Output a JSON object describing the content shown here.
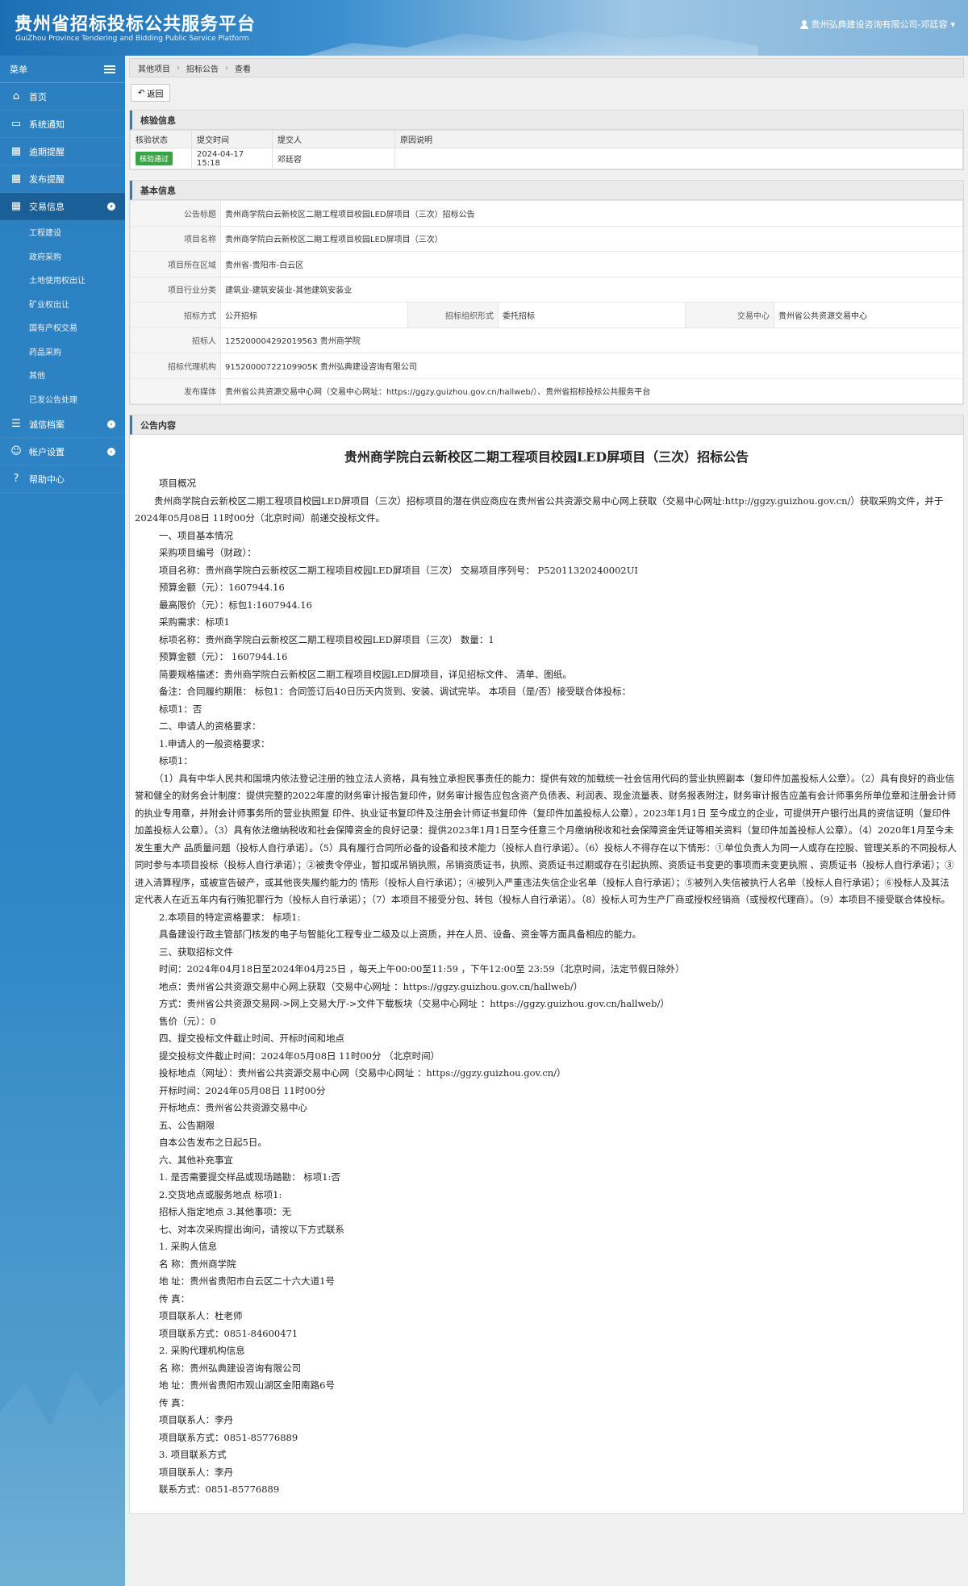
{
  "header": {
    "title": "贵州省招标投标公共服务平台",
    "subtitle": "GuiZhou Province Tendering and Bidding Public Service Platform",
    "user": "贵州弘典建设咨询有限公司-邓廷容"
  },
  "sidebar": {
    "menu_label": "菜单",
    "items": [
      {
        "label": "首页",
        "icon": "home-icon"
      },
      {
        "label": "系统通知",
        "icon": "monitor-icon"
      },
      {
        "label": "逾期提醒",
        "icon": "calendar-icon"
      },
      {
        "label": "发布提醒",
        "icon": "calendar-icon"
      },
      {
        "label": "交易信息",
        "icon": "calendar-icon"
      }
    ],
    "sub_items": [
      "工程建设",
      "政府采购",
      "土地使用权出让",
      "矿业权出让",
      "国有产权交易",
      "药品采购",
      "其他",
      "已发公告处理"
    ],
    "bottom_items": [
      {
        "label": "诚信档案",
        "icon": "list-icon"
      },
      {
        "label": "帐户设置",
        "icon": "user-icon"
      },
      {
        "label": "帮助中心",
        "icon": "help-icon"
      }
    ]
  },
  "breadcrumb": [
    "其他项目",
    "招标公告",
    "查看"
  ],
  "toolbar": {
    "back_label": "返回"
  },
  "audit": {
    "title": "核验信息",
    "headers": [
      "核验状态",
      "提交时间",
      "提交人",
      "原因说明"
    ],
    "status": "核验通过",
    "submit_time": "2024-04-17 15:18",
    "submitter": "邓廷容",
    "reason": ""
  },
  "basic": {
    "title": "基本信息",
    "notice_title_label": "公告标题",
    "notice_title": "贵州商学院白云新校区二期工程项目校园LED屏项目（三次）招标公告",
    "project_name_label": "项目名称",
    "project_name": "贵州商学院白云新校区二期工程项目校园LED屏项目（三次）",
    "region_label": "项目所在区域",
    "region": "贵州省-贵阳市-白云区",
    "industry_label": "项目行业分类",
    "industry": "建筑业-建筑安装业-其他建筑安装业",
    "method_label": "招标方式",
    "method": "公开招标",
    "org_form_label": "招标组织形式",
    "org_form": "委托招标",
    "center_label": "交易中心",
    "center": "贵州省公共资源交易中心",
    "tenderer_label": "招标人",
    "tenderer": "125200004292019563 贵州商学院",
    "agency_label": "招标代理机构",
    "agency": "91520000722109905K 贵州弘典建设咨询有限公司",
    "media_label": "发布媒体",
    "media": "贵州省公共资源交易中心网（交易中心网址：https://ggzy.guizhou.gov.cn/hallweb/）、贵州省招标投标公共服务平台"
  },
  "notice": {
    "section_title": "公告内容",
    "title": "贵州商学院白云新校区二期工程项目校园LED屏项目（三次）招标公告",
    "paragraphs": [
      "项目概况",
      "贵州商学院白云新校区二期工程项目校园LED屏项目（三次）招标项目的潜在供应商应在贵州省公共资源交易中心网上获取（交易中心网址:http://ggzy.guizhou.gov.cn/）获取采购文件，并于2024年05月08日 11时00分（北京时间）前递交投标文件。",
      "一、项目基本情况",
      "采购项目编号（财政）：",
      "项目名称：贵州商学院白云新校区二期工程项目校园LED屏项目（三次）   交易项目序列号： P52011320240002UI",
      "预算金额（元）：1607944.16",
      "最高限价（元）：标包1:1607944.16",
      "采购需求：标项1",
      "标项名称：贵州商学院白云新校区二期工程项目校园LED屏项目（三次）   数量：1",
      "预算金额（元）：  1607944.16",
      "简要规格描述：贵州商学院白云新校区二期工程项目校园LED屏项目，详见招标文件、  清单、图纸。",
      "备注：合同履约期限：  标包1：合同签订后40日历天内货到、安装、调试完毕。   本项目（是/否）接受联合体投标：",
      "标项1：否",
      "二、申请人的资格要求：",
      "1.申请人的一般资格要求：",
      "标项1：",
      "（1）具有中华人民共和国境内依法登记注册的独立法人资格，具有独立承担民事责任的能力：提供有效的加载统一社会信用代码的营业执照副本（复印件加盖投标人公章）。（2）具有良好的商业信誉和健全的财务会计制度：提供完整的2022年度的财务审计报告复印件，财务审计报告应包含资产负债表、利润表、现金流量表、财务报表附注，财务审计报告应盖有会计师事务所单位章和注册会计师的执业专用章，并附会计师事务所的营业执照复 印件、执业证书复印件及注册会计师证书复印件（复印件加盖投标人公章），2023年1月1日 至今成立的企业，可提供开户银行出具的资信证明（复印件加盖投标人公章）。（3）具有依法缴纳税收和社会保障资金的良好记录：提供2023年1月1日至今任意三个月缴纳税收和社会保障资金凭证等相关资料（复印件加盖投标人公章）。（4）2020年1月至今未发生重大产 品质量问题（投标人自行承诺）。（5）具有履行合同所必备的设备和技术能力（投标人自行承诺）。（6）投标人不得存在以下情形：①单位负责人为同一人或存在控股、管理关系的不同投标人同时参与本项目投标（投标人自行承诺）；②被责令停业，暂扣或吊销执照，吊销资质证书，执照、资质证书过期或存在引起执照、资质证书变更的事项而未变更执照 、资质证书（投标人自行承诺）；③进入清算程序，或被宣告破产，或其他丧失履约能力的 情形（投标人自行承诺）；④被列入严重违法失信企业名单（投标人自行承诺）；⑤被列入失信被执行人名单（投标人自行承诺）；⑥投标人及其法定代表人在近五年内有行贿犯罪行为（投标人自行承诺）；（7）本项目不接受分包、转包（投标人自行承诺）。（8）投标人可为生产厂商或授权经销商（或授权代理商）。（9）本项目不接受联合体投标。",
      "2.本项目的特定资格要求：  标项1:",
      "具备建设行政主管部门核发的电子与智能化工程专业二级及以上资质，并在人员、设备、资金等方面具备相应的能力。",
      "三、获取招标文件",
      "时间：2024年04月18日至2024年04月25日 ，每天上午00:00至11:59 ，下午12:00至  23:59（北京时间，法定节假日除外）",
      "地点：贵州省公共资源交易中心网上获取（交易中心网址  ：https://ggzy.guizhou.gov.cn/hallweb/）",
      "方式：贵州省公共资源交易网->网上交易大厅->文件下载板块（交易中心网址  ：https://ggzy.guizhou.gov.cn/hallweb/）",
      "售价（元）：0",
      "四、提交投标文件截止时间、开标时间和地点",
      "提交投标文件截止时间：2024年05月08日 11时00分 （北京时间）",
      "投标地点（网址）：贵州省公共资源交易中心网（交易中心网址  ：https://ggzy.guizhou.gov.cn/）",
      "开标时间：2024年05月08日 11时00分",
      "开标地点：贵州省公共资源交易中心",
      "五、公告期限",
      "自本公告发布之日起5日。",
      "六、其他补充事宜",
      "1. 是否需要提交样品或现场踏勘：  标项1:否",
      "2.交货地点或服务地点  标项1:",
      "招标人指定地点  3.其他事项：无",
      "七、对本次采购提出询问，请按以下方式联系",
      "1. 采购人信息",
      "名 称：贵州商学院",
      "地 址：贵州省贵阳市白云区二十六大道1号",
      "传  真：",
      "项目联系人：杜老师",
      "项目联系方式：0851-84600471",
      "2. 采购代理机构信息",
      "名 称：贵州弘典建设咨询有限公司",
      "地 址：贵州省贵阳市观山湖区金阳南路6号",
      "传  真：",
      "项目联系人：李丹",
      "项目联系方式：0851-85776889",
      "3. 项目联系方式",
      "项目联系人：李丹",
      "联系方式：0851-85776889"
    ]
  },
  "colors": {
    "primary": "#2b7fc0",
    "active_nav": "#1a5f97",
    "success": "#3aa346"
  }
}
